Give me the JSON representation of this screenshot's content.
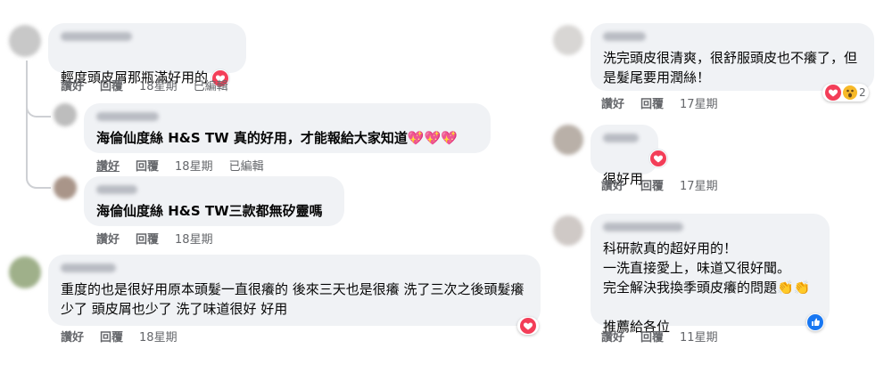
{
  "comments": [
    {
      "text": "輕度頭皮屑那瓶滿好用的",
      "like": "讚好",
      "reply": "回覆",
      "time": "18星期",
      "edited": "已編輯"
    },
    {
      "text": "海倫仙度絲 H&S TW 真的好用，才能報給大家知道💖💖💖",
      "like": "讚好",
      "reply": "回覆",
      "time": "18星期",
      "edited": "已編輯"
    },
    {
      "text": "海倫仙度絲 H&S TW三款都無矽靈嗎",
      "like": "讚好",
      "reply": "回覆",
      "time": "18星期"
    },
    {
      "text": "重度的也是很好用原本頭髮一直很癢的 後來三天也是很癢 洗了三次之後頭髮癢少了 頭皮屑也少了 洗了味道很好 好用",
      "like": "讚好",
      "reply": "回覆",
      "time": "18星期"
    },
    {
      "text": "洗完頭皮很清爽，很舒服頭皮也不癢了，但是髮尾要用潤絲！",
      "like": "讚好",
      "reply": "回覆",
      "time": "17星期",
      "reaction_count": "2"
    },
    {
      "text": "很好用",
      "like": "讚好",
      "reply": "回覆",
      "time": "17星期"
    },
    {
      "text": "科研款真的超好用的！\n一洗直接愛上，味道又很好聞。\n完全解決我換季頭皮癢的問題👏👏\n\n推薦給各位",
      "like": "讚好",
      "reply": "回覆",
      "time": "11星期"
    }
  ],
  "icons": {
    "heart": "heart-react-icon",
    "wow": "wow-react-icon",
    "like": "like-react-icon"
  },
  "colors": {
    "heart": "#f33e58",
    "like": "#1877f2",
    "bubble": "#f0f2f5",
    "meta": "#65676b"
  }
}
